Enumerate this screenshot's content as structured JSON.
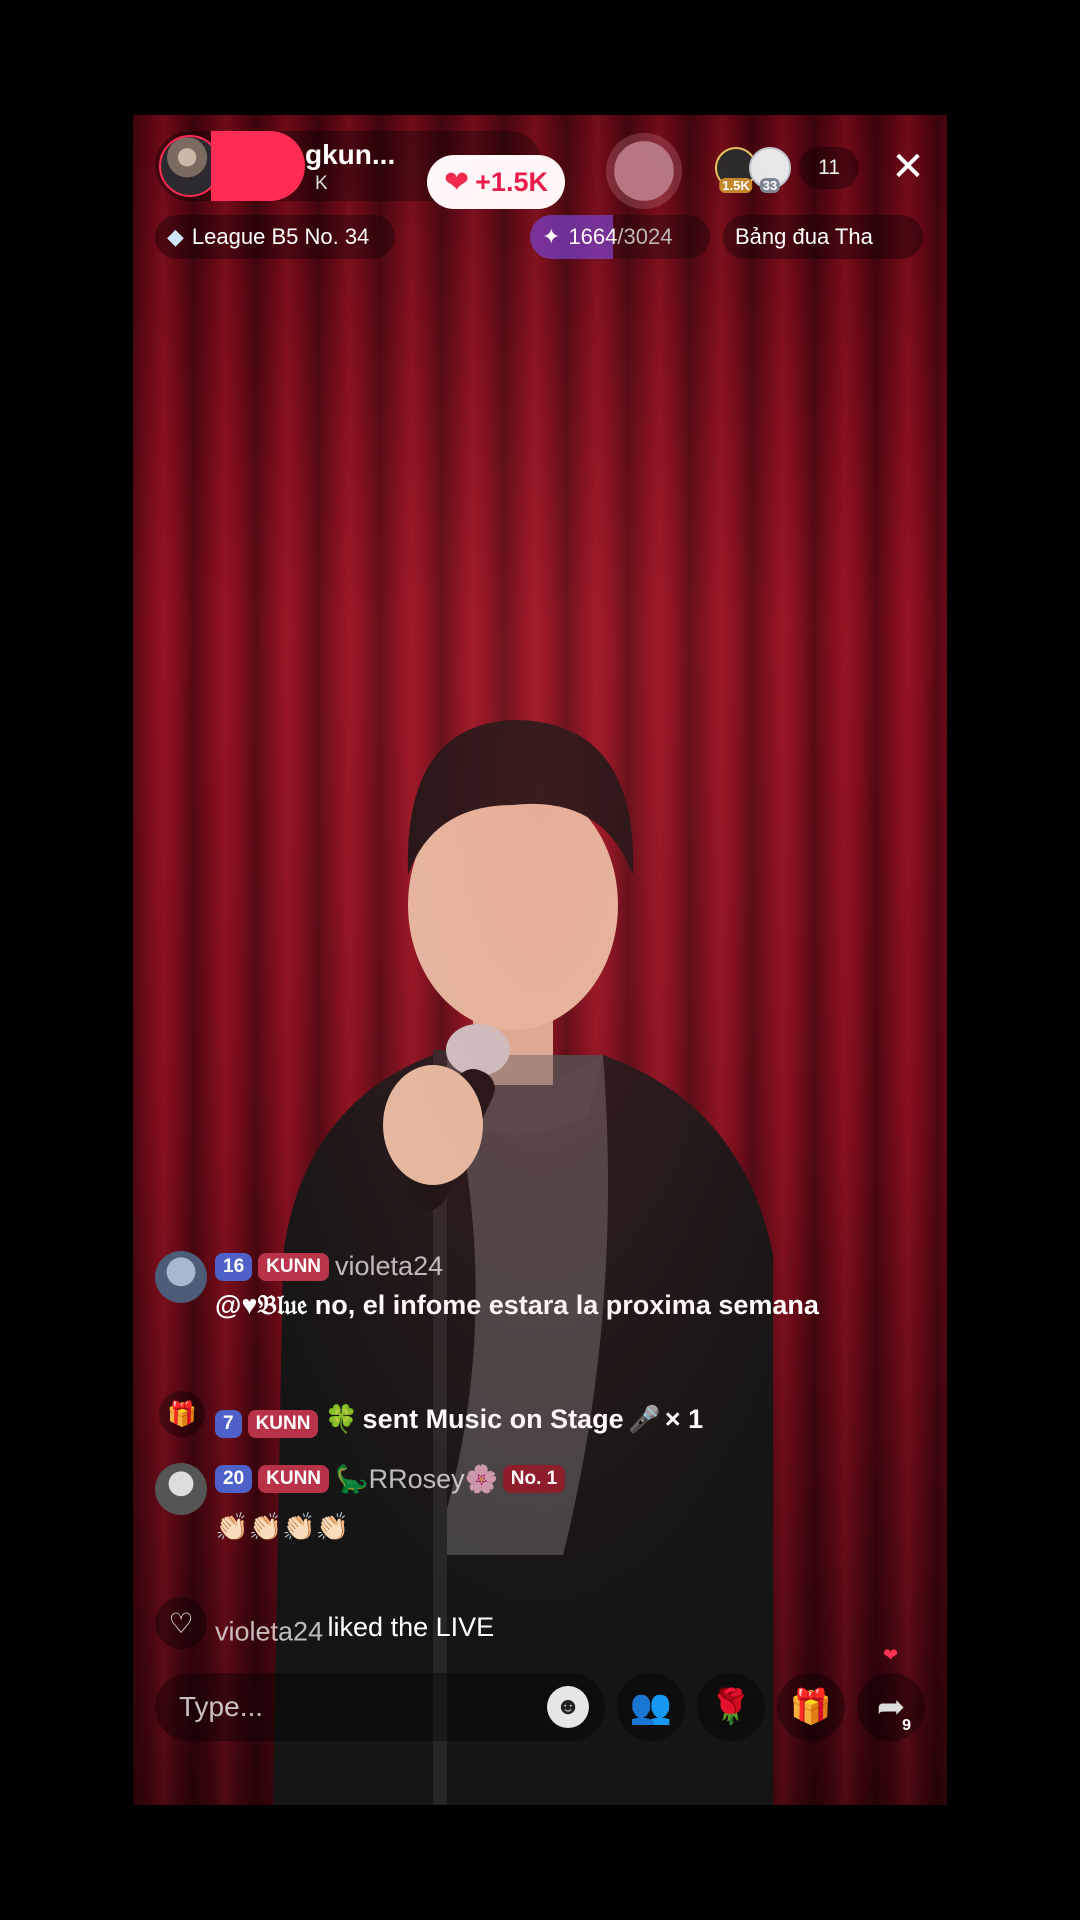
{
  "host": {
    "name": "gkun...",
    "likes": "K",
    "like_badge": "+1.5K"
  },
  "viewers": {
    "avatar1_badge": "1.5K",
    "avatar2_badge": "33",
    "count": "11"
  },
  "chips": {
    "league": "League B5 No. 34",
    "gift_current": "1664",
    "gift_total": "/3024",
    "ranking": "Bảng đua Tha"
  },
  "chat": [
    {
      "level": "16",
      "fan_badge": "KUNN",
      "user": "violeta24",
      "text": "@♥𝔅𝔩𝔲𝔢 no, el infome estara la proxima semana"
    },
    {
      "level": "7",
      "fan_badge": "KUNN",
      "user": "🍀",
      "text": "sent Music on Stage",
      "suffix": "× 1"
    },
    {
      "level": "20",
      "fan_badge": "KUNN",
      "user": "🦕RRosey🌸",
      "rank_badge": "No. 1",
      "text": "👏🏻👏🏻👏🏻👏🏻"
    }
  ],
  "like_event": {
    "user": "violeta24",
    "text": "liked the LIVE"
  },
  "bottom_bar": {
    "placeholder": "Type...",
    "share_count": "9"
  },
  "icons": [
    "profile-avatar",
    "close-icon",
    "diamond-icon",
    "gift-icon",
    "heart-icon",
    "emoji-icon",
    "people-icon",
    "rose-icon",
    "gift-box-icon",
    "share-icon"
  ]
}
